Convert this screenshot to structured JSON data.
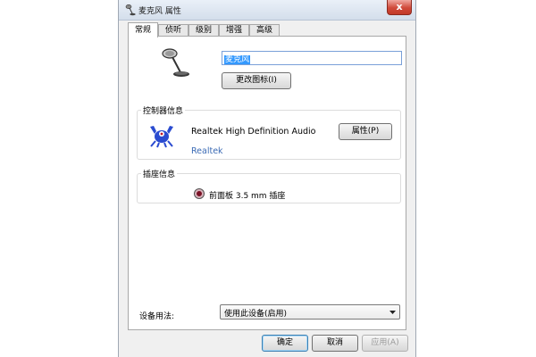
{
  "window": {
    "title": "麦克风 属性",
    "close_glyph": "x"
  },
  "tabs": [
    {
      "label": "常规",
      "active": true
    },
    {
      "label": "侦听",
      "active": false
    },
    {
      "label": "级别",
      "active": false
    },
    {
      "label": "增强",
      "active": false
    },
    {
      "label": "高级",
      "active": false
    }
  ],
  "general": {
    "device_name": "麦克风",
    "change_icon_label": "更改图标(I)"
  },
  "controller": {
    "legend": "控制器信息",
    "name": "Realtek High Definition Audio",
    "vendor": "Realtek",
    "properties_label": "属性(P)"
  },
  "jack": {
    "legend": "插座信息",
    "description": "前面板 3.5 mm 插座",
    "color": "#7a1226"
  },
  "usage": {
    "label": "设备用法:",
    "selected": "使用此设备(启用)"
  },
  "footer": {
    "ok_label": "确定",
    "cancel_label": "取消",
    "apply_label": "应用(A)"
  }
}
